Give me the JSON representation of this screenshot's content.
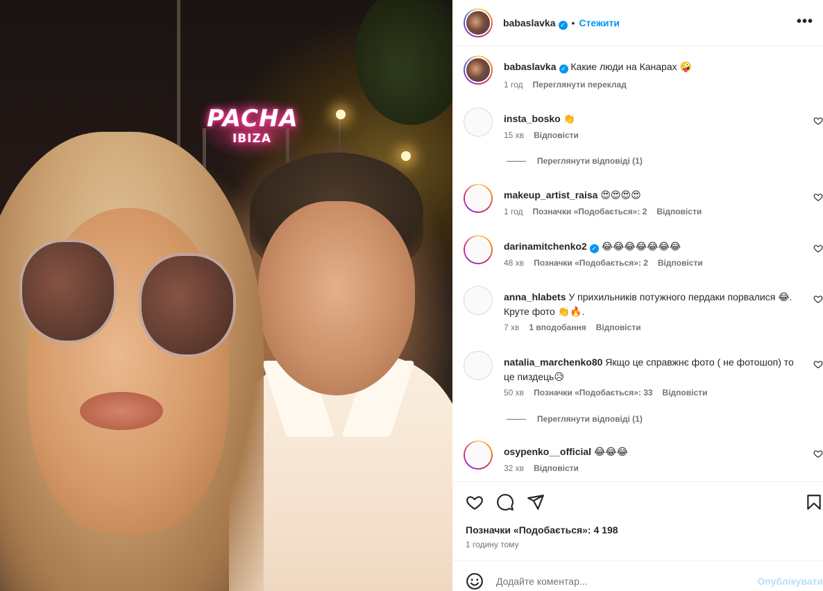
{
  "photo": {
    "sign_line1": "PACHA",
    "sign_line2": "IBIZA"
  },
  "header": {
    "username": "babaslavka",
    "separator": "•",
    "follow_label": "Стежити",
    "more_label": "•••"
  },
  "caption": {
    "username": "babaslavka",
    "text": "Какие люди на Канарах 🤪",
    "time": "1 год",
    "translate_label": "Переглянути переклад"
  },
  "comments": [
    {
      "username": "insta_bosko",
      "text": "👏",
      "time": "15 хв",
      "likes": "",
      "reply_label": "Відповісти",
      "view_replies": "Переглянути відповіді (1)"
    },
    {
      "username": "makeup_artist_raisa",
      "text": "😍😍😍😍",
      "time": "1 год",
      "likes": "Позначки «Подобається»: 2",
      "reply_label": "Відповісти"
    },
    {
      "username": "darinamitchenko2",
      "text": "😂😂😂😂😂😂😂",
      "time": "48 хв",
      "likes": "Позначки «Подобається»: 2",
      "reply_label": "Відповісти"
    },
    {
      "username": "anna_hlabets",
      "text": "У прихильників потужного пердаки порвалися 😂. Круте фото 👏🔥.",
      "time": "7 хв",
      "likes": "1 вподобання",
      "reply_label": "Відповісти"
    },
    {
      "username": "natalia_marchenko80",
      "text": "Якщо це справжнє фото ( не фотошоп) то це пиздець😥",
      "time": "50 хв",
      "likes": "Позначки «Подобається»: 33",
      "reply_label": "Відповісти",
      "view_replies": "Переглянути відповіді (1)"
    },
    {
      "username": "osypenko__official",
      "text": "😂😂😂",
      "time": "32 хв",
      "likes": "",
      "reply_label": "Відповісти"
    }
  ],
  "footer": {
    "likes": "Позначки «Подобається»: 4 198",
    "posted": "1 годину тому",
    "comment_placeholder": "Додайте коментар...",
    "publish_label": "Опублікувати"
  },
  "colors": {
    "accent": "#0095f6",
    "muted": "#737373",
    "text": "#262626",
    "publish_disabled": "#b3dffc"
  }
}
